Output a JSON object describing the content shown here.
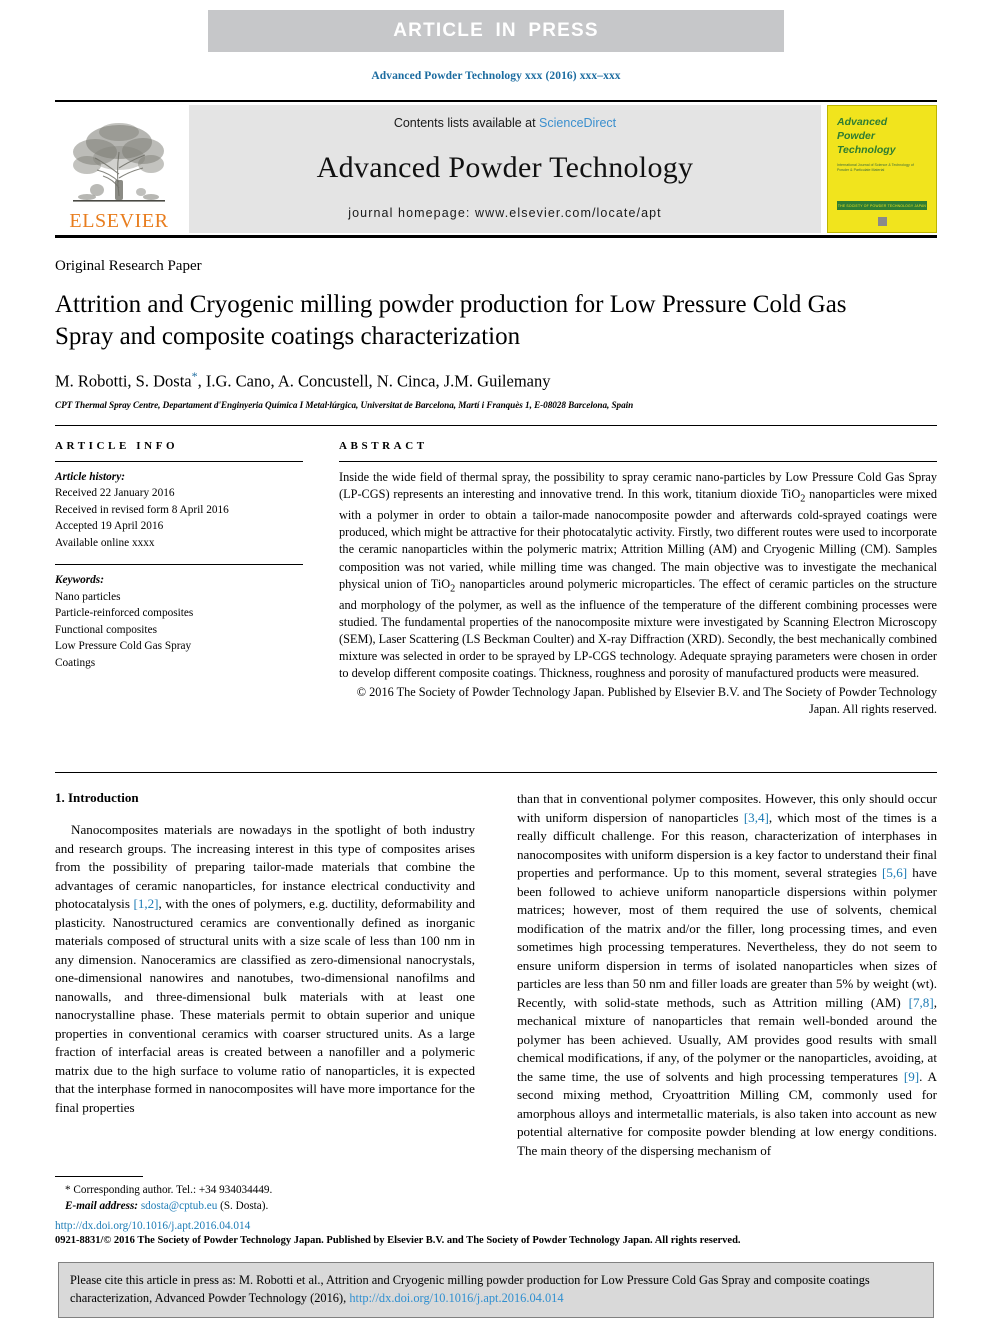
{
  "banner": {
    "text": "ARTICLE IN PRESS"
  },
  "running_head": "Advanced Powder Technology xxx (2016) xxx–xxx",
  "masthead": {
    "contents_prefix": "Contents lists available at ",
    "contents_link": "ScienceDirect",
    "journal_title": "Advanced Powder Technology",
    "homepage": "journal homepage: www.elsevier.com/locate/apt",
    "publisher_name": "ELSEVIER",
    "cover": {
      "title_line1": "Advanced",
      "title_line2": "Powder",
      "title_line3": "Technology",
      "subtitle": "International Journal of Science & Technology of Powder & Particulate Material",
      "green_bar_text": "THE SOCIETY OF POWDER TECHNOLOGY JAPAN",
      "footer_mark": "ELSEVIER"
    }
  },
  "article": {
    "paper_type": "Original Research Paper",
    "title": "Attrition and Cryogenic milling powder production for Low Pressure Cold Gas Spray and composite coatings characterization",
    "authors_prefix": "M. Robotti, S. Dosta",
    "corresponding_marker": "*",
    "authors_suffix": ", I.G. Cano, A. Concustell, N. Cinca, J.M. Guilemany",
    "affiliation": "CPT Thermal Spray Centre, Departament d'Enginyeria Química I Metal·lúrgica, Universitat de Barcelona, Martí i Franquès 1, E-08028 Barcelona, Spain"
  },
  "article_info": {
    "label": "ARTICLE INFO",
    "history_label": "Article history:",
    "history": [
      "Received 22 January 2016",
      "Received in revised form 8 April 2016",
      "Accepted 19 April 2016",
      "Available online xxxx"
    ],
    "keywords_label": "Keywords:",
    "keywords": [
      "Nano particles",
      "Particle-reinforced composites",
      "Functional composites",
      "Low Pressure Cold Gas Spray",
      "Coatings"
    ]
  },
  "abstract": {
    "label": "ABSTRACT",
    "body": "Inside the wide field of thermal spray, the possibility to spray ceramic nano-particles by Low Pressure Cold Gas Spray (LP-CGS) represents an interesting and innovative trend. In this work, titanium dioxide TiO2 nanoparticles were mixed with a polymer in order to obtain a tailor-made nanocomposite powder and afterwards cold-sprayed coatings were produced, which might be attractive for their photocatalytic activity. Firstly, two different routes were used to incorporate the ceramic nanoparticles within the polymeric matrix; Attrition Milling (AM) and Cryogenic Milling (CM). Samples composition was not varied, while milling time was changed. The main objective was to investigate the mechanical physical union of TiO2 nanoparticles around polymeric microparticles. The effect of ceramic particles on the structure and morphology of the polymer, as well as the influence of the temperature of the different combining processes were studied. The fundamental properties of the nanocomposite mixture were investigated by Scanning Electron Microscopy (SEM), Laser Scattering (LS Beckman Coulter) and X-ray Diffraction (XRD). Secondly, the best mechanically combined mixture was selected in order to be sprayed by LP-CGS technology. Adequate spraying parameters were chosen in order to develop different composite coatings. Thickness, roughness and porosity of manufactured products were measured.",
    "copyright": "© 2016 The Society of Powder Technology Japan. Published by Elsevier B.V. and The Society of Powder Technology Japan. All rights reserved."
  },
  "introduction": {
    "heading": "1. Introduction",
    "left_para": "Nanocomposites materials are nowadays in the spotlight of both industry and research groups. The increasing interest in this type of composites arises from the possibility of preparing tailor-made materials that combine the advantages of ceramic nanoparticles, for instance electrical conductivity and photocatalysis [1,2], with the ones of polymers, e.g. ductility, deformability and plasticity. Nanostructured ceramics are conventionally defined as inorganic materials composed of structural units with a size scale of less than 100 nm in any dimension. Nanoceramics are classified as zero-dimensional nanocrystals, one-dimensional nanowires and nanotubes, two-dimensional nanofilms and nanowalls, and three-dimensional bulk materials with at least one nanocrystalline phase. These materials permit to obtain superior and unique properties in conventional ceramics with coarser structured units. As a large fraction of interfacial areas is created between a nanofiller and a polymeric matrix due to the high surface to volume ratio of nanoparticles, it is expected that the interphase formed in nanocomposites will have more importance for the final properties",
    "right_para": "than that in conventional polymer composites. However, this only should occur with uniform dispersion of nanoparticles [3,4], which most of the times is a really difficult challenge. For this reason, characterization of interphases in nanocomposites with uniform dispersion is a key factor to understand their final properties and performance. Up to this moment, several strategies [5,6] have been followed to achieve uniform nanoparticle dispersions within polymer matrices; however, most of them required the use of solvents, chemical modification of the matrix and/or the filler, long processing times, and even sometimes high processing temperatures. Nevertheless, they do not seem to ensure uniform dispersion in terms of isolated nanoparticles when sizes of particles are less than 50 nm and filler loads are greater than 5% by weight (wt). Recently, with solid-state methods, such as Attrition milling (AM) [7,8], mechanical mixture of nanoparticles that remain well-bonded around the polymer has been achieved. Usually, AM provides good results with small chemical modifications, if any, of the polymer or the nanoparticles, avoiding, at the same time, the use of solvents and high processing temperatures [9]. A second mixing method, Cryoattrition Milling CM, commonly used for amorphous alloys and intermetallic materials, is also taken into account as new potential alternative for composite powder blending at low energy conditions. The main theory of the dispersing mechanism of"
  },
  "footnote": {
    "marker": "*",
    "corresponding": "Corresponding author. Tel.: +34 934034449.",
    "email_label": "E-mail address:",
    "email": "sdosta@cptub.eu",
    "email_suffix": "(S. Dosta)."
  },
  "imprint": {
    "doi": "http://dx.doi.org/10.1016/j.apt.2016.04.014",
    "copyright_line": "0921-8831/© 2016 The Society of Powder Technology Japan. Published by Elsevier B.V. and The Society of Powder Technology Japan. All rights reserved."
  },
  "cite_box": {
    "text_before": "Please cite this article in press as: M. Robotti et al., Attrition and Cryogenic milling powder production for Low Pressure Cold Gas Spray and composite coatings characterization, Advanced Powder Technology (2016), ",
    "link": "http://dx.doi.org/10.1016/j.apt.2016.04.014"
  }
}
